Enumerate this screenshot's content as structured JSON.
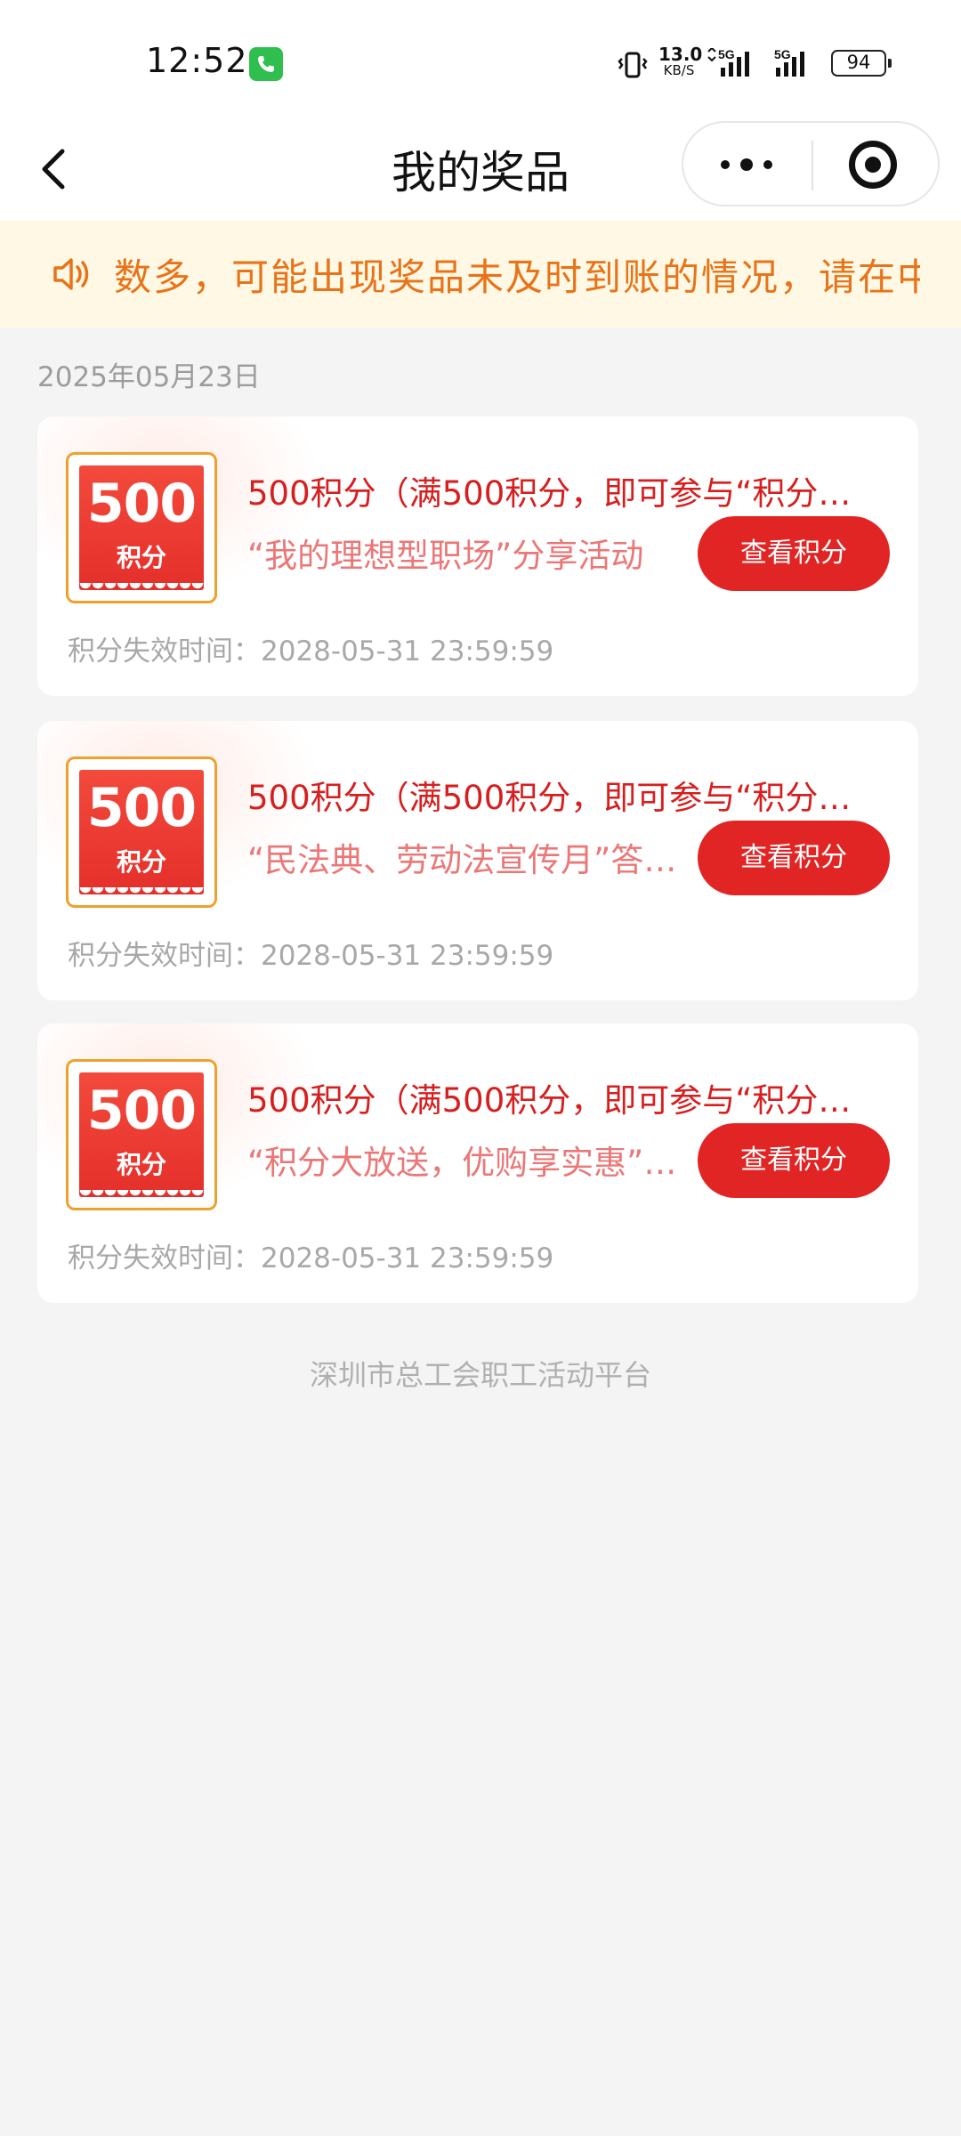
{
  "status_bar": {
    "time": "12:52",
    "net_speed_value": "13.0",
    "net_speed_unit": "KB/S",
    "sig1_label": "5G",
    "sig2_label": "5G",
    "battery": "94"
  },
  "nav": {
    "title": "我的奖品",
    "back_icon": "chevron-left-icon",
    "more_icon": "more-dots-icon",
    "close_icon": "target-close-icon"
  },
  "notice": {
    "icon": "speaker-icon",
    "text": "数多，可能出现奖品未及时到账的情况，请在中奖"
  },
  "date_label": "2025年05月23日",
  "prizes": [
    {
      "badge_value": "500",
      "badge_unit": "积分",
      "title": "500积分（满500积分，即可参与“积分…",
      "subtitle": "“我的理想型职场”分享活动",
      "button": "查看积分",
      "expire": "积分失效时间：2028-05-31 23:59:59"
    },
    {
      "badge_value": "500",
      "badge_unit": "积分",
      "title": "500积分（满500积分，即可参与“积分…",
      "subtitle": "“民法典、劳动法宣传月”答…",
      "button": "查看积分",
      "expire": "积分失效时间：2028-05-31 23:59:59"
    },
    {
      "badge_value": "500",
      "badge_unit": "积分",
      "title": "500积分（满500积分，即可参与“积分…",
      "subtitle": "“积分大放送，优购享实惠”…",
      "button": "查看积分",
      "expire": "积分失效时间：2028-05-31 23:59:59"
    }
  ],
  "footer": "深圳市总工会职工活动平台",
  "colors": {
    "accent_red": "#e12525",
    "title_red": "#d61f1f",
    "notice_orange": "#e87318",
    "notice_bg": "#fff8e4",
    "badge_border": "#f0a02c"
  }
}
